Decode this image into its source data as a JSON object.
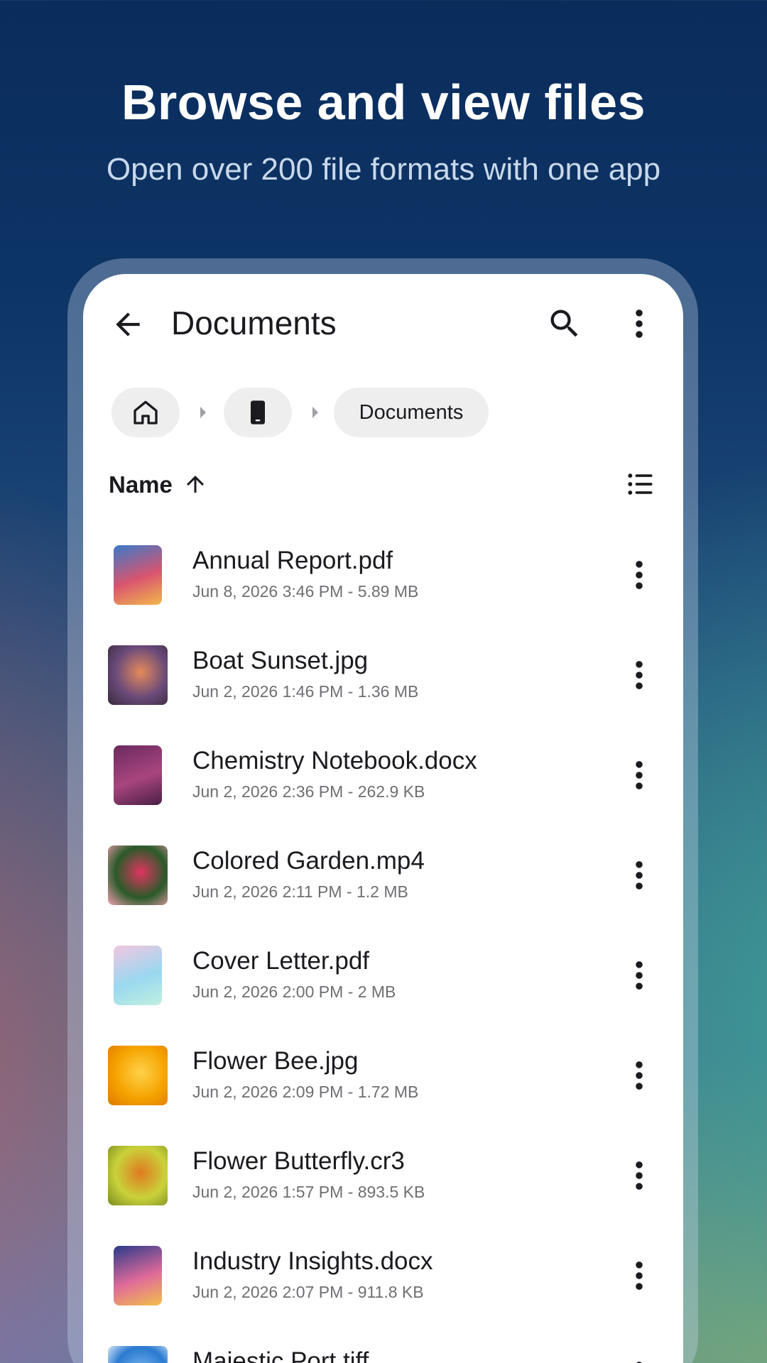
{
  "promo": {
    "headline": "Browse and view files",
    "subline": "Open over 200 file formats with one app"
  },
  "appbar": {
    "title": "Documents",
    "icons": [
      "back-arrow-icon",
      "search-icon",
      "more-vert-icon"
    ]
  },
  "breadcrumb": {
    "home_icon": "home-icon",
    "device_icon": "phone-icon",
    "current": "Documents"
  },
  "sort": {
    "label": "Name",
    "direction_icon": "arrow-up-icon",
    "view_icon": "list-view-icon"
  },
  "files": [
    {
      "name": "Annual Report.pdf",
      "meta": "Jun 8, 2026 3:46 PM - 5.89 MB",
      "thumb": "doc",
      "colors": [
        "#3a7ac9",
        "#d9556f",
        "#f2b84b"
      ]
    },
    {
      "name": "Boat Sunset.jpg",
      "meta": "Jun 2, 2026 1:46 PM - 1.36 MB",
      "thumb": "photo",
      "colors": [
        "#6a4a7a",
        "#e58a5a",
        "#3a2a3a"
      ]
    },
    {
      "name": "Chemistry Notebook.docx",
      "meta": "Jun 2, 2026 2:36 PM - 262.9 KB",
      "thumb": "doc",
      "colors": [
        "#6b2a5e",
        "#a8457f",
        "#4a1f45"
      ]
    },
    {
      "name": "Colored Garden.mp4",
      "meta": "Jun 2, 2026 2:11 PM - 1.2 MB",
      "thumb": "photo",
      "colors": [
        "#2a5a2a",
        "#e0355f",
        "#f5a0b0"
      ]
    },
    {
      "name": "Cover Letter.pdf",
      "meta": "Jun 2, 2026 2:00 PM - 2 MB",
      "thumb": "doc",
      "colors": [
        "#f2c6e0",
        "#9ad8f0",
        "#c0f0e0"
      ]
    },
    {
      "name": "Flower Bee.jpg",
      "meta": "Jun 2, 2026 2:09 PM - 1.72 MB",
      "thumb": "photo",
      "colors": [
        "#f5a300",
        "#ffd24a",
        "#e07800"
      ]
    },
    {
      "name": "Flower Butterfly.cr3",
      "meta": "Jun 2, 2026 1:57 PM - 893.5 KB",
      "thumb": "photo",
      "colors": [
        "#c9d23a",
        "#e07a20",
        "#7a8a20"
      ]
    },
    {
      "name": "Industry Insights.docx",
      "meta": "Jun 2, 2026 2:07 PM - 911.8 KB",
      "thumb": "doc",
      "colors": [
        "#2a3a8a",
        "#e06a9a",
        "#f2c04a"
      ]
    },
    {
      "name": "Majestic Port.tiff",
      "meta": "",
      "thumb": "photo",
      "colors": [
        "#2a7ad0",
        "#7ab8f0",
        "#ffffff"
      ]
    }
  ]
}
